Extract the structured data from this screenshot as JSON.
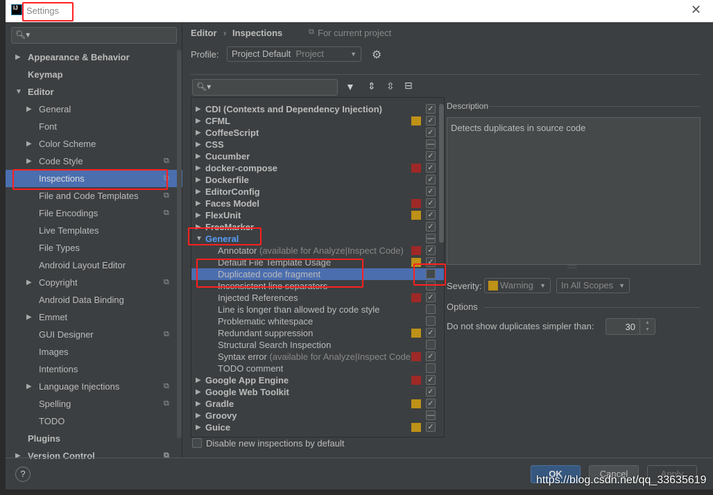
{
  "window": {
    "title": "Settings",
    "app_icon": "IJ",
    "close_icon": "close-icon"
  },
  "sidebar": {
    "items": [
      {
        "label": "Appearance & Behavior",
        "level": 0,
        "arrow": "right",
        "bold": true
      },
      {
        "label": "Keymap",
        "level": 0,
        "bold": true
      },
      {
        "label": "Editor",
        "level": 0,
        "arrow": "down",
        "bold": true
      },
      {
        "label": "General",
        "level": 1,
        "arrow": "right"
      },
      {
        "label": "Font",
        "level": 1
      },
      {
        "label": "Color Scheme",
        "level": 1,
        "arrow": "right"
      },
      {
        "label": "Code Style",
        "level": 1,
        "arrow": "right",
        "copy": true
      },
      {
        "label": "Inspections",
        "level": 1,
        "copy": true,
        "selected": true
      },
      {
        "label": "File and Code Templates",
        "level": 1,
        "copy": true
      },
      {
        "label": "File Encodings",
        "level": 1,
        "copy": true
      },
      {
        "label": "Live Templates",
        "level": 1
      },
      {
        "label": "File Types",
        "level": 1
      },
      {
        "label": "Android Layout Editor",
        "level": 1
      },
      {
        "label": "Copyright",
        "level": 1,
        "arrow": "right",
        "copy": true
      },
      {
        "label": "Android Data Binding",
        "level": 1
      },
      {
        "label": "Emmet",
        "level": 1,
        "arrow": "right"
      },
      {
        "label": "GUI Designer",
        "level": 1,
        "copy": true
      },
      {
        "label": "Images",
        "level": 1
      },
      {
        "label": "Intentions",
        "level": 1
      },
      {
        "label": "Language Injections",
        "level": 1,
        "arrow": "right",
        "copy": true
      },
      {
        "label": "Spelling",
        "level": 1,
        "copy": true
      },
      {
        "label": "TODO",
        "level": 1
      },
      {
        "label": "Plugins",
        "level": 0,
        "bold": true
      },
      {
        "label": "Version Control",
        "level": 0,
        "arrow": "right",
        "bold": true,
        "copy": true
      }
    ]
  },
  "breadcrumb": {
    "parent": "Editor",
    "current": "Inspections",
    "scope_note": "For current project"
  },
  "profile": {
    "label": "Profile:",
    "value": "Project Default",
    "value_hint": "Project"
  },
  "colors": {
    "error": "#9e2927",
    "warning": "#be9117",
    "selection": "#4b6eaf",
    "general_text": "#589df6"
  },
  "tree": [
    {
      "label": "CDI (Contexts and Dependency Injection)",
      "group": true,
      "state": "checked"
    },
    {
      "label": "CFML",
      "group": true,
      "marker": "warning",
      "state": "checked"
    },
    {
      "label": "CoffeeScript",
      "group": true,
      "state": "checked"
    },
    {
      "label": "CSS",
      "group": true,
      "state": "mixed"
    },
    {
      "label": "Cucumber",
      "group": true,
      "state": "checked"
    },
    {
      "label": "docker-compose",
      "group": true,
      "marker": "error",
      "state": "checked"
    },
    {
      "label": "Dockerfile",
      "group": true,
      "state": "checked"
    },
    {
      "label": "EditorConfig",
      "group": true,
      "state": "checked"
    },
    {
      "label": "Faces Model",
      "group": true,
      "marker": "error",
      "state": "checked"
    },
    {
      "label": "FlexUnit",
      "group": true,
      "marker": "warning",
      "state": "checked"
    },
    {
      "label": "FreeMarker",
      "group": true,
      "state": "checked"
    },
    {
      "label": "General",
      "group": true,
      "expanded": true,
      "state": "mixed",
      "highlight": true
    },
    {
      "label": "Annotator",
      "hint": "(available for Analyze|Inspect Code)",
      "marker": "error",
      "state": "checked"
    },
    {
      "label": "Default File Template Usage",
      "marker": "warning",
      "state": "checked"
    },
    {
      "label": "Duplicated code fragment",
      "state": "unchecked",
      "selected": true
    },
    {
      "label": "Inconsistent line separators",
      "state": "unchecked"
    },
    {
      "label": "Injected References",
      "marker": "error",
      "state": "checked"
    },
    {
      "label": "Line is longer than allowed by code style",
      "state": "unchecked"
    },
    {
      "label": "Problematic whitespace",
      "state": "unchecked"
    },
    {
      "label": "Redundant suppression",
      "marker": "warning",
      "state": "checked"
    },
    {
      "label": "Structural Search Inspection",
      "state": "unchecked"
    },
    {
      "label": "Syntax error",
      "hint": "(available for Analyze|Inspect Code)",
      "marker": "error",
      "state": "checked"
    },
    {
      "label": "TODO comment",
      "state": "unchecked"
    },
    {
      "label": "Google App Engine",
      "group": true,
      "marker": "error",
      "state": "checked"
    },
    {
      "label": "Google Web Toolkit",
      "group": true,
      "state": "checked"
    },
    {
      "label": "Gradle",
      "group": true,
      "marker": "warning",
      "state": "checked"
    },
    {
      "label": "Groovy",
      "group": true,
      "state": "mixed"
    },
    {
      "label": "Guice",
      "group": true,
      "marker": "warning",
      "state": "checked"
    }
  ],
  "disable_new": {
    "label": "Disable new inspections by default",
    "checked": false
  },
  "description": {
    "header": "Description",
    "text": "Detects duplicates in source code"
  },
  "severity": {
    "label": "Severity:",
    "value": "Warning",
    "scope": "In All Scopes"
  },
  "options": {
    "header": "Options",
    "field_label": "Do not show duplicates simpler than:",
    "value": "30"
  },
  "buttons": {
    "help": "?",
    "ok": "OK",
    "cancel": "Cancel",
    "apply": "Apply"
  },
  "watermark": "https://blog.csdn.net/qq_33635619"
}
